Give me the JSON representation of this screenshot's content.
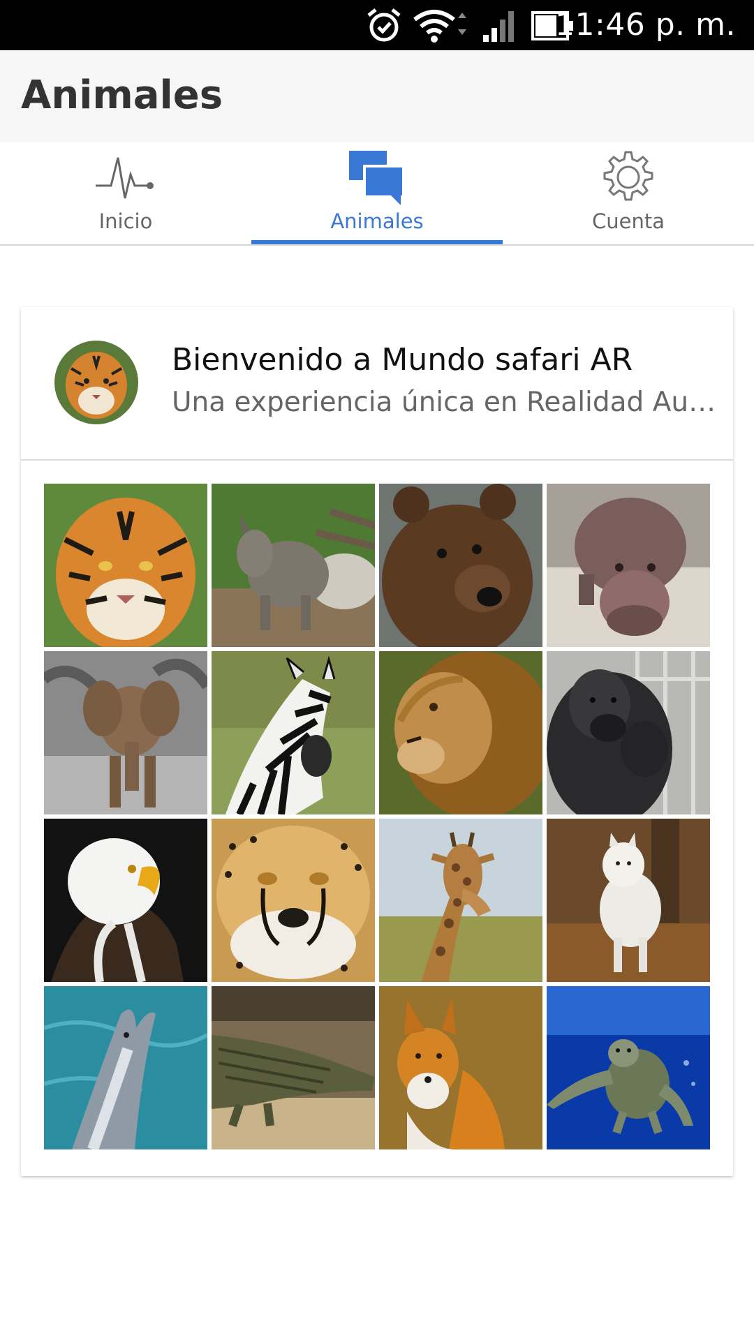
{
  "status_bar": {
    "time": "11:46 p. m.",
    "icons": [
      "alarm-icon",
      "wifi-icon",
      "signal-icon",
      "battery-icon"
    ]
  },
  "app_bar": {
    "title": "Animales"
  },
  "tabs": [
    {
      "label": "Inicio",
      "icon": "pulse-icon",
      "active": false
    },
    {
      "label": "Animales",
      "icon": "chat-bubbles-icon",
      "active": true
    },
    {
      "label": "Cuenta",
      "icon": "gear-icon",
      "active": false
    }
  ],
  "card": {
    "title": "Bienvenido a Mundo safari AR",
    "subtitle": "Una experiencia única en Realidad Au…",
    "avatar": "tiger-avatar"
  },
  "grid": {
    "items": [
      {
        "animal": "tiger"
      },
      {
        "animal": "rhinoceros"
      },
      {
        "animal": "bear"
      },
      {
        "animal": "hippopotamus"
      },
      {
        "animal": "elephant"
      },
      {
        "animal": "zebra"
      },
      {
        "animal": "lion"
      },
      {
        "animal": "gorilla"
      },
      {
        "animal": "eagle"
      },
      {
        "animal": "cheetah"
      },
      {
        "animal": "giraffe"
      },
      {
        "animal": "wolf"
      },
      {
        "animal": "dolphin"
      },
      {
        "animal": "crocodile"
      },
      {
        "animal": "fox"
      },
      {
        "animal": "sea-turtle"
      }
    ]
  },
  "colors": {
    "accent": "#3a78d6",
    "status_bar": "#000000",
    "app_bar": "#f6f6f6"
  }
}
